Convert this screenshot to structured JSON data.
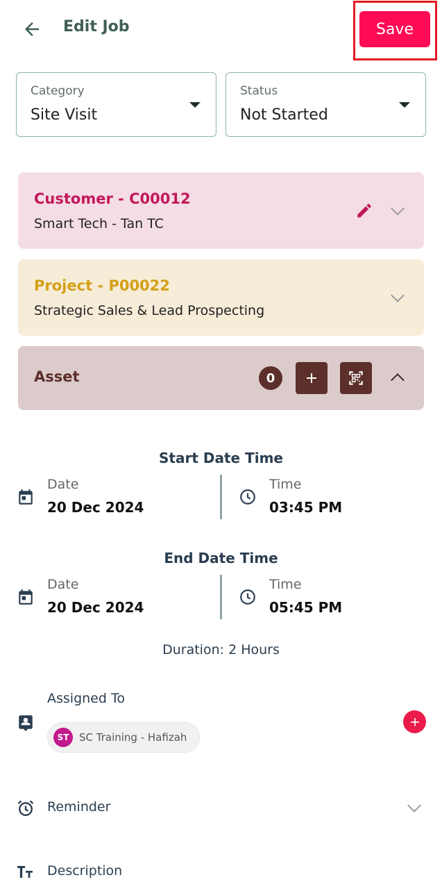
{
  "header": {
    "title": "Edit Job",
    "save_label": "Save"
  },
  "fields": {
    "category": {
      "label": "Category",
      "value": "Site Visit"
    },
    "status": {
      "label": "Status",
      "value": "Not Started"
    }
  },
  "customer": {
    "title": "Customer  -  C00012",
    "name": "Smart Tech - Tan TC",
    "color": "#c2185b"
  },
  "project": {
    "title": "Project  -  P00022",
    "name": "Strategic Sales & Lead Prospecting",
    "color": "#d4a017"
  },
  "asset": {
    "title": "Asset",
    "count": "0",
    "color": "#5c2f2a"
  },
  "start": {
    "section_title": "Start Date Time",
    "date_label": "Date",
    "date_value": "20 Dec 2024",
    "time_label": "Time",
    "time_value": "03:45 PM"
  },
  "end": {
    "section_title": "End Date Time",
    "date_label": "Date",
    "date_value": "20 Dec 2024",
    "time_label": "Time",
    "time_value": "05:45 PM"
  },
  "duration": "Duration: 2 Hours",
  "assigned": {
    "label": "Assigned To",
    "people": [
      {
        "initials": "ST",
        "name": "SC Training - Hafizah"
      }
    ]
  },
  "reminder": {
    "label": "Reminder"
  },
  "description": {
    "label": "Description"
  }
}
